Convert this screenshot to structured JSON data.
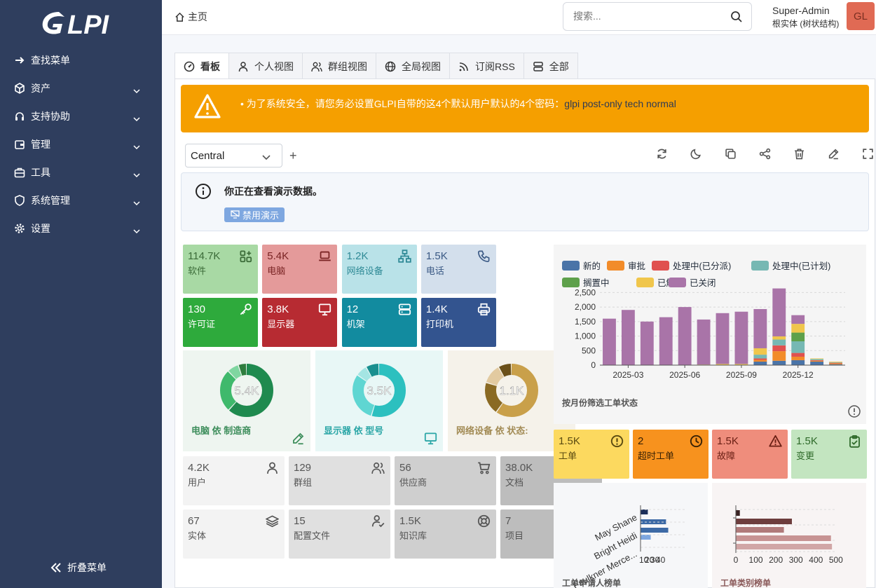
{
  "app": {
    "logo_text": "GLPI"
  },
  "sidebar": {
    "items": [
      {
        "label": "查找菜单",
        "icon": "arrow-right-icon",
        "has_chevron": false
      },
      {
        "label": "资产",
        "icon": "cube-icon",
        "has_chevron": true
      },
      {
        "label": "支持协助",
        "icon": "headset-icon",
        "has_chevron": true
      },
      {
        "label": "管理",
        "icon": "wallet-icon",
        "has_chevron": true
      },
      {
        "label": "工具",
        "icon": "briefcase-icon",
        "has_chevron": true
      },
      {
        "label": "系统管理",
        "icon": "shield-icon",
        "has_chevron": true
      },
      {
        "label": "设置",
        "icon": "gear-icon",
        "has_chevron": true
      }
    ],
    "collapse_label": "折叠菜单"
  },
  "header": {
    "breadcrumb": "主页",
    "search_placeholder": "搜索...",
    "user_name": "Super-Admin",
    "entity": "根实体 (树状结构)",
    "avatar_initials": "GL"
  },
  "tabs": [
    {
      "label": "看板",
      "icon": "gauge-icon",
      "active": true
    },
    {
      "label": "个人视图",
      "icon": "user-icon",
      "active": false
    },
    {
      "label": "群组视图",
      "icon": "users-icon",
      "active": false
    },
    {
      "label": "全局视图",
      "icon": "globe-icon",
      "active": false
    },
    {
      "label": "订阅RSS",
      "icon": "rss-icon",
      "active": false
    },
    {
      "label": "全部",
      "icon": "list-icon",
      "active": false
    }
  ],
  "alert": {
    "message": "为了系统安全，请您务必设置GLPI自带的这4个默认用户默认的4个密码：",
    "passwords": "glpi post-only tech normal"
  },
  "dashboard": {
    "selected": "Central",
    "toolbar_icons": [
      "refresh-icon",
      "moon-icon",
      "copy-icon",
      "share-icon",
      "trash-icon",
      "edit-icon",
      "fullscreen-icon"
    ]
  },
  "demo_info": {
    "text": "你正在查看演示数据。",
    "button": "禁用演示"
  },
  "stat_cards_top": [
    {
      "value": "114.7K",
      "label": "软件",
      "icon": "apps-add-icon",
      "bg": "#a8d9a4",
      "fg": "#3b6b38"
    },
    {
      "value": "5.4K",
      "label": "电脑",
      "icon": "laptop-icon",
      "bg": "#e49a9a",
      "fg": "#7a2424"
    },
    {
      "value": "1.2K",
      "label": "网络设备",
      "icon": "network-icon",
      "bg": "#b9e2e8",
      "fg": "#2f8a96"
    },
    {
      "value": "1.5K",
      "label": "电话",
      "icon": "phone-icon",
      "bg": "#d3dfec",
      "fg": "#3b5a85"
    },
    {
      "value": "130",
      "label": "许可证",
      "icon": "key-icon",
      "bg": "#2eaa3c",
      "fg": "#ffffff"
    },
    {
      "value": "3.8K",
      "label": "显示器",
      "icon": "monitor-icon",
      "bg": "#b72b32",
      "fg": "#ffffff"
    },
    {
      "value": "12",
      "label": "机架",
      "icon": "server-icon",
      "bg": "#128b9f",
      "fg": "#ffffff"
    },
    {
      "value": "1.4K",
      "label": "打印机",
      "icon": "printer-icon",
      "bg": "#33548f",
      "fg": "#ffffff"
    }
  ],
  "donuts": [
    {
      "value": "5.4K",
      "title": "电脑 依 制造商",
      "icon": "edit-icon",
      "bg": "#eef5f0",
      "fg": "#3e8e5c",
      "colors": [
        "#1f8a4f",
        "#3fb96c",
        "#7fd6a0",
        "#2e7d3e"
      ],
      "fractions": [
        0.62,
        0.26,
        0.07,
        0.05
      ]
    },
    {
      "value": "3.5K",
      "title": "显示器 依 型号",
      "icon": "monitor-icon",
      "bg": "#e8f7f6",
      "fg": "#2aa6a6",
      "colors": [
        "#2cc0bf",
        "#5fd6d2",
        "#a4e5e3",
        "#1a8f8f"
      ],
      "fractions": [
        0.55,
        0.3,
        0.07,
        0.08
      ]
    },
    {
      "value": "1.1K",
      "title": "网络设备 依 状态:",
      "icon": "tag-icon",
      "bg": "#f5f2ea",
      "fg": "#a28b55",
      "colors": [
        "#c9a04a",
        "#8a6a23",
        "#e2caa0",
        "#6b5019"
      ],
      "fractions": [
        0.6,
        0.2,
        0.12,
        0.08
      ]
    }
  ],
  "stat_cards_bottom": [
    {
      "value": "4.2K",
      "label": "用户",
      "icon": "user-icon",
      "bg": "#f3f3f3"
    },
    {
      "value": "129",
      "label": "群组",
      "icon": "users-icon",
      "bg": "#e0e0e0"
    },
    {
      "value": "56",
      "label": "供应商",
      "icon": "cart-icon",
      "bg": "#cfcfcf"
    },
    {
      "value": "38.0K",
      "label": "文档",
      "icon": "files-icon",
      "bg": "#bdbdbd"
    },
    {
      "value": "67",
      "label": "实体",
      "icon": "layers-icon",
      "bg": "#f3f3f3"
    },
    {
      "value": "15",
      "label": "配置文件",
      "icon": "user-check-icon",
      "bg": "#e0e0e0"
    },
    {
      "value": "1.5K",
      "label": "知识库",
      "icon": "lifebuoy-icon",
      "bg": "#cfcfcf"
    },
    {
      "value": "7",
      "label": "项目",
      "icon": "layout-icon",
      "bg": "#bdbdbd"
    }
  ],
  "ticket_cards": [
    {
      "value": "1.5K",
      "label": "工单",
      "icon": "alert-circle-icon",
      "bg": "#fcd95f",
      "fg": "#5a4a10"
    },
    {
      "value": "2",
      "label": "超时工单",
      "icon": "clock-icon",
      "bg": "#f7921e",
      "fg": "#3a2205"
    },
    {
      "value": "1.5K",
      "label": "故障",
      "icon": "warning-icon",
      "bg": "#ef8d7c",
      "fg": "#6a1f14"
    },
    {
      "value": "1.5K",
      "label": "变更",
      "icon": "clipboard-check-icon",
      "bg": "#c3e5c0",
      "fg": "#2f6a2a"
    }
  ],
  "chart_data": [
    {
      "type": "bar",
      "title": "按月份筛选工单状态",
      "stacked": true,
      "categories": [
        "2025-02",
        "2025-03",
        "2025-04",
        "2025-05",
        "2025-06",
        "2025-07",
        "2025-08",
        "2025-09",
        "2025-10",
        "2025-11",
        "2025-12",
        "2026-01",
        "2026-02"
      ],
      "x_tick_labels": [
        "2025-03",
        "2025-06",
        "2025-09",
        "2025-12"
      ],
      "ylim": [
        0,
        2750
      ],
      "y_ticks": [
        "0",
        "500",
        "1,000",
        "1,500",
        "2,000",
        "2,500"
      ],
      "legend_position": "top",
      "series": [
        {
          "name": "新的",
          "color": "#4a74a8",
          "values": [
            0,
            0,
            0,
            0,
            0,
            0,
            0,
            0,
            120,
            150,
            170,
            120,
            30
          ]
        },
        {
          "name": "审批",
          "color": "#f28c2a",
          "values": [
            0,
            0,
            0,
            0,
            0,
            0,
            0,
            0,
            60,
            330,
            120,
            30,
            30
          ]
        },
        {
          "name": "处理中(已分派)",
          "color": "#e0514f",
          "values": [
            0,
            0,
            0,
            0,
            0,
            0,
            0,
            0,
            50,
            200,
            130,
            20,
            20
          ]
        },
        {
          "name": "处理中(已计划)",
          "color": "#76b8b3",
          "values": [
            0,
            0,
            0,
            0,
            0,
            0,
            0,
            0,
            130,
            200,
            400,
            40,
            20
          ]
        },
        {
          "name": "搁置中",
          "color": "#5ea04b",
          "values": [
            0,
            0,
            0,
            0,
            0,
            0,
            0,
            0,
            0,
            0,
            300,
            0,
            0
          ]
        },
        {
          "name": "已解决",
          "color": "#f0c64c",
          "values": [
            0,
            0,
            0,
            0,
            0,
            20,
            40,
            40,
            220,
            110,
            300,
            20,
            20
          ]
        },
        {
          "name": "已关闭",
          "color": "#a974a8",
          "values": [
            1600,
            1900,
            1500,
            1650,
            2000,
            1550,
            1750,
            1800,
            1350,
            1650,
            300,
            0,
            0
          ]
        }
      ]
    },
    {
      "type": "bar",
      "orientation": "horizontal",
      "title": "工单申请人榜单",
      "categories": [
        "May Shane",
        "Bright Heidi",
        "Faulkner Merce..."
      ],
      "x_tick_labels": [
        "10",
        "20",
        "30",
        "40"
      ],
      "series": [
        {
          "name": "",
          "color": "#1c2f5a",
          "values": [
            10
          ]
        },
        {
          "name": "",
          "color": "#3d6aa6",
          "values": [
            35
          ]
        },
        {
          "name": "",
          "color": "#3d6aa6",
          "values": [
            38
          ]
        },
        {
          "name": "",
          "color": "#7ea7e0",
          "values": [
            14
          ]
        }
      ]
    },
    {
      "type": "bar",
      "orientation": "horizontal",
      "title": "工单类别榜单",
      "x_tick_labels": [
        "0",
        "100",
        "200",
        "300",
        "400",
        "500"
      ],
      "xlim": [
        0,
        560
      ],
      "series": [
        {
          "name": "",
          "color": "#3a2222",
          "values": [
            20
          ]
        },
        {
          "name": "",
          "color": "#6d3d3d",
          "values": [
            280
          ]
        },
        {
          "name": "",
          "color": "#b07a7a",
          "values": [
            240
          ]
        },
        {
          "name": "",
          "color": "#c79393",
          "values": [
            475
          ]
        },
        {
          "name": "",
          "color": "#d1a6a6",
          "values": [
            480
          ]
        }
      ]
    }
  ]
}
